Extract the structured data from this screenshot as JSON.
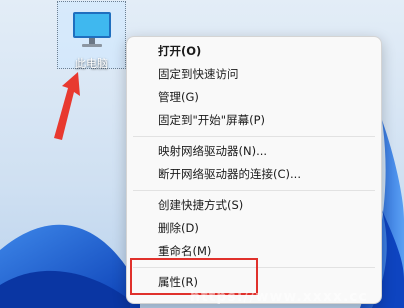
{
  "desktop": {
    "icon_label": "此电脑",
    "icon_name": "monitor-icon"
  },
  "context_menu": {
    "groups": [
      [
        {
          "label": "打开(O)",
          "bold": true
        },
        {
          "label": "固定到快速访问"
        },
        {
          "label": "管理(G)"
        },
        {
          "label": "固定到\"开始\"屏幕(P)"
        }
      ],
      [
        {
          "label": "映射网络驱动器(N)..."
        },
        {
          "label": "断开网络驱动器的连接(C)..."
        }
      ],
      [
        {
          "label": "创建快捷方式(S)"
        },
        {
          "label": "删除(D)"
        },
        {
          "label": "重命名(M)"
        }
      ],
      [
        {
          "label": "属性(R)"
        }
      ]
    ]
  },
  "annotations": {
    "arrow_color": "#e8392f",
    "highlight_color": "#e0312c"
  },
  "watermark": "https://www.xxxx.cc"
}
